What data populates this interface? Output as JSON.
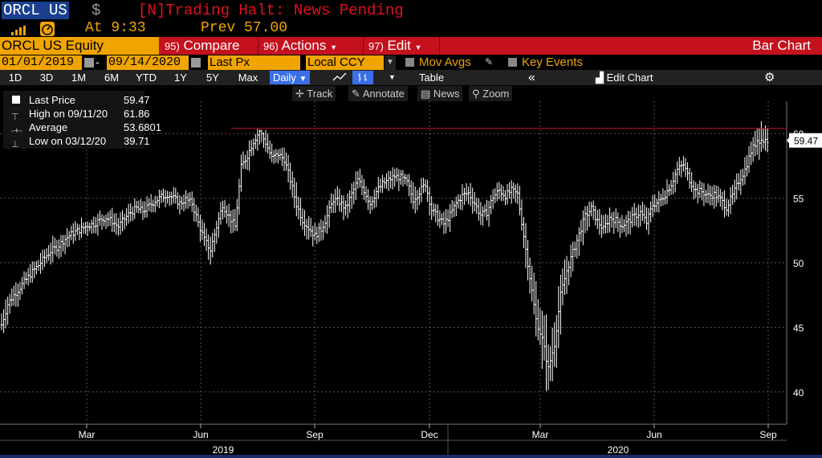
{
  "header": {
    "ticker": "ORCL US",
    "currency_symbol": "$",
    "halt_message": "[N]Trading Halt: News Pending",
    "at_label": "At 9:33",
    "prev_label": "Prev 57.00"
  },
  "menubar": {
    "security": "ORCL US Equity",
    "compare_num": "95)",
    "compare_label": "Compare",
    "actions_num": "96)",
    "actions_label": "Actions",
    "edit_num": "97)",
    "edit_label": "Edit",
    "title": "Bar Chart"
  },
  "fields": {
    "start_date": "01/01/2019",
    "end_date": "09/14/2020",
    "price_field": "Last Px",
    "currency": "Local CCY",
    "mov_avgs": "Mov Avgs",
    "key_events": "Key Events"
  },
  "periods": [
    "1D",
    "3D",
    "1M",
    "6M",
    "YTD",
    "1Y",
    "5Y",
    "Max"
  ],
  "frequency": "Daily",
  "table_label": "Table",
  "edit_chart_label": "Edit Chart",
  "tools": {
    "track": "Track",
    "annotate": "Annotate",
    "news": "News",
    "zoom": "Zoom"
  },
  "legend": {
    "last_label": "Last Price",
    "last_value": "59.47",
    "high_label": "High on 09/11/20",
    "high_value": "61.86",
    "avg_label": "Average",
    "avg_value": "53.6801",
    "low_label": "Low on 03/12/20",
    "low_value": "39.71"
  },
  "colors": {
    "background": "#000000",
    "accent_orange": "#f0a400",
    "menu_red": "#c4111d",
    "halt_red": "#e1101e",
    "bar_color": "#ffffff",
    "high_line": "#c8102e",
    "grid": "#555555"
  },
  "chart_data": {
    "type": "bar",
    "title": "",
    "xlabel": "",
    "ylabel": "",
    "ylim": [
      37.5,
      62.5
    ],
    "y_ticks": [
      40,
      45,
      50,
      55,
      60
    ],
    "last_price_tag": "59.47",
    "high_line_value": 60.4,
    "x_month_labels": [
      "Mar",
      "Jun",
      "Sep",
      "Dec",
      "Mar",
      "Jun",
      "Sep"
    ],
    "x_year_labels": [
      "2019",
      "2020"
    ],
    "series": [
      {
        "x_start": "2019-01-02",
        "x_end": "2020-09-14",
        "closes": [
          45.2,
          46.8,
          47.5,
          48.1,
          48.7,
          49.3,
          49.8,
          50.4,
          50.9,
          51.2,
          51.7,
          52.1,
          52.4,
          52.6,
          52.9,
          53.0,
          53.3,
          53.5,
          53.2,
          52.8,
          53.4,
          53.9,
          54.2,
          54.0,
          54.4,
          54.8,
          55.1,
          55.3,
          55.0,
          54.6,
          54.9,
          54.6,
          53.1,
          51.8,
          51.0,
          52.8,
          54.5,
          53.6,
          52.8,
          57.4,
          58.3,
          59.4,
          60.2,
          59.3,
          58.1,
          58.4,
          58.0,
          56.4,
          54.5,
          53.3,
          52.7,
          52.1,
          52.6,
          53.6,
          54.9,
          54.7,
          54.2,
          55.3,
          56.4,
          55.6,
          54.6,
          55.5,
          56.1,
          56.4,
          56.7,
          56.6,
          56.2,
          54.9,
          55.5,
          56.1,
          54.1,
          53.5,
          53.0,
          53.7,
          54.6,
          55.2,
          55.4,
          54.6,
          53.7,
          53.9,
          55.1,
          55.6,
          55.2,
          55.6,
          55.3,
          52.1,
          48.9,
          45.6,
          44.1,
          41.8,
          43.7,
          47.5,
          49.4,
          50.8,
          52.2,
          53.6,
          54.2,
          53.2,
          52.6,
          53.5,
          53.3,
          52.9,
          53.2,
          53.6,
          53.9,
          53.1,
          54.5,
          54.7,
          55.3,
          56.1,
          57.2,
          57.6,
          56.4,
          55.6,
          55.5,
          55.2,
          55.3,
          54.9,
          54.3,
          55.2,
          56.3,
          57.2,
          58.6,
          59.5,
          59.47
        ],
        "highs": [
          46.4,
          47.9,
          48.5,
          49.0,
          49.6,
          50.2,
          50.8,
          51.3,
          51.8,
          52.1,
          52.5,
          52.9,
          53.2,
          53.4,
          53.6,
          53.8,
          54.1,
          54.3,
          54.0,
          53.6,
          54.2,
          54.7,
          55.1,
          54.9,
          55.2,
          55.6,
          55.8,
          56.0,
          55.7,
          55.3,
          55.6,
          55.4,
          54.0,
          52.9,
          51.9,
          53.8,
          55.3,
          54.5,
          53.7,
          58.4,
          59.4,
          60.2,
          60.4,
          60.2,
          59.0,
          59.2,
          58.9,
          57.4,
          55.8,
          54.3,
          53.7,
          53.1,
          53.5,
          54.6,
          55.9,
          55.6,
          55.2,
          56.3,
          57.2,
          56.6,
          55.5,
          56.3,
          56.8,
          57.1,
          57.3,
          57.2,
          56.8,
          56.0,
          56.4,
          57.0,
          55.1,
          54.4,
          53.9,
          54.5,
          55.4,
          56.1,
          56.3,
          55.5,
          54.6,
          54.8,
          56.0,
          56.4,
          56.0,
          56.4,
          56.1,
          53.2,
          50.3,
          47.6,
          46.7,
          43.9,
          45.9,
          49.0,
          50.6,
          51.9,
          53.3,
          54.4,
          55.0,
          54.1,
          53.5,
          54.3,
          54.1,
          53.8,
          54.1,
          54.5,
          54.8,
          54.0,
          55.4,
          55.6,
          56.2,
          56.9,
          57.9,
          58.3,
          57.3,
          56.4,
          56.3,
          56.0,
          56.1,
          55.8,
          55.2,
          56.1,
          57.3,
          58.2,
          59.8,
          61.86,
          60.9
        ],
        "lows": [
          44.3,
          45.8,
          46.6,
          47.3,
          47.9,
          48.5,
          49.0,
          49.6,
          50.1,
          50.4,
          50.9,
          51.3,
          51.6,
          51.8,
          52.1,
          52.2,
          52.5,
          52.7,
          52.4,
          52.0,
          52.6,
          53.1,
          53.4,
          53.2,
          53.6,
          54.0,
          54.3,
          54.5,
          54.2,
          53.8,
          54.1,
          53.8,
          52.2,
          50.3,
          49.8,
          51.8,
          53.5,
          52.6,
          51.9,
          56.5,
          57.3,
          58.5,
          59.4,
          58.4,
          57.2,
          57.5,
          57.0,
          55.4,
          53.5,
          52.3,
          51.7,
          51.1,
          51.6,
          52.6,
          53.9,
          53.7,
          53.2,
          54.3,
          55.4,
          54.6,
          53.7,
          54.6,
          55.2,
          55.5,
          55.8,
          55.7,
          55.3,
          53.8,
          54.6,
          55.2,
          53.2,
          52.6,
          52.1,
          52.8,
          53.7,
          54.3,
          54.5,
          53.7,
          52.8,
          53.0,
          54.2,
          54.7,
          54.3,
          54.7,
          54.4,
          50.6,
          47.2,
          43.8,
          41.6,
          39.71,
          41.9,
          45.6,
          47.9,
          49.6,
          50.9,
          52.4,
          53.3,
          52.3,
          51.6,
          52.5,
          52.3,
          51.9,
          52.2,
          52.6,
          52.9,
          52.2,
          53.6,
          53.8,
          54.4,
          55.2,
          56.3,
          56.8,
          55.5,
          54.7,
          54.6,
          54.3,
          54.4,
          54.0,
          53.4,
          54.3,
          55.3,
          56.2,
          57.4,
          58.2,
          58.6
        ]
      }
    ]
  }
}
